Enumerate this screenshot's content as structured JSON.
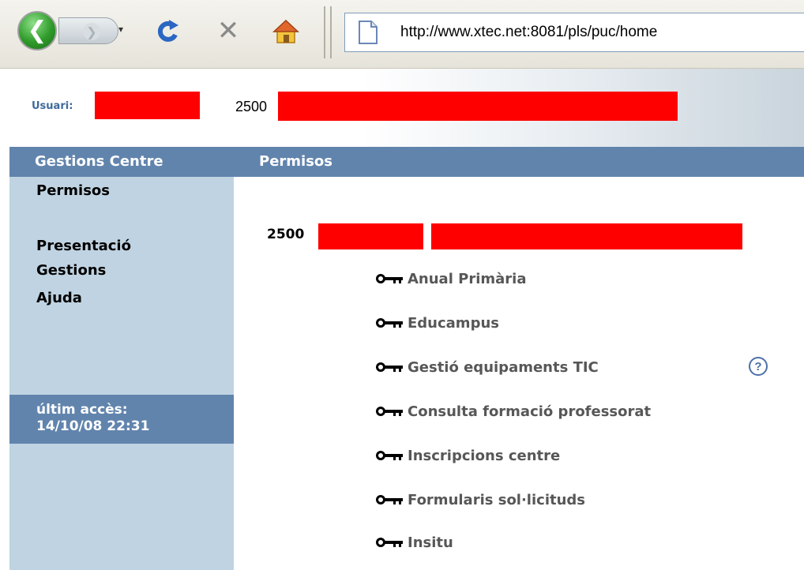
{
  "browser": {
    "url": "http://www.xtec.net:8081/pls/puc/home",
    "back_glyph": "❮",
    "forward_glyph": "❯",
    "dropdown_glyph": "▾",
    "stop_glyph": "✕"
  },
  "header": {
    "user_label": "Usuari:",
    "code_prefix": "2500"
  },
  "nav": {
    "left_title": "Gestions Centre",
    "right_title": "Permisos"
  },
  "sidebar": {
    "items": [
      {
        "label": "Permisos"
      },
      {
        "label": "Presentació"
      },
      {
        "label": "Gestions"
      },
      {
        "label": "Ajuda"
      }
    ],
    "last_access_label": "últim accès:",
    "last_access_value": "14/10/08 22:31"
  },
  "main": {
    "center_code_prefix": "2500",
    "links": [
      {
        "label": "Anual Primària"
      },
      {
        "label": "Educampus"
      },
      {
        "label": "Gestió equipaments TIC"
      },
      {
        "label": "Consulta formació professorat"
      },
      {
        "label": "Inscripcions centre"
      },
      {
        "label": "Formularis sol·licituds"
      },
      {
        "label": "Insitu"
      }
    ],
    "help_glyph": "?"
  },
  "colors": {
    "navbar": "#6184ad",
    "sidebar": "#c0d3e2",
    "redaction": "#ff0000",
    "user_label": "#3f6a9c",
    "link_text": "#575757"
  },
  "icons": [
    "back-arrow-icon",
    "forward-arrow-icon",
    "reload-icon",
    "stop-icon",
    "home-icon",
    "page-icon",
    "key-icon",
    "help-icon"
  ]
}
